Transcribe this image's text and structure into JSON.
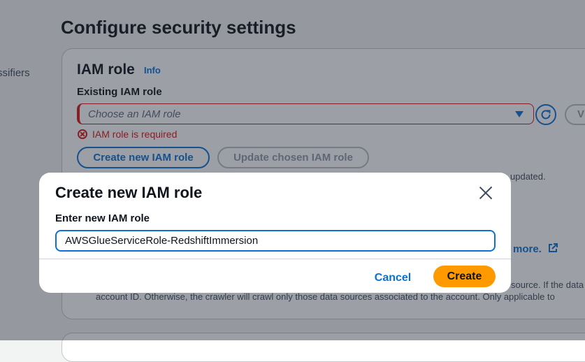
{
  "sidebar": {
    "partial_item": "ssifiers"
  },
  "page": {
    "title": "Configure security settings"
  },
  "iam_section": {
    "heading": "IAM role",
    "info_label": "Info",
    "field_label": "Existing IAM role",
    "select_placeholder": "Choose an IAM role",
    "view_label": "V",
    "error_text": "IAM role is required",
    "create_button": "Create new IAM role",
    "update_button": "Update chosen IAM role",
    "updated_text": "updated.",
    "learn_more": "more.",
    "description_line1": "source. If the data",
    "description_line2": "account ID. Otherwise, the crawler will crawl only those data sources associated to the account. Only applicable to"
  },
  "modal": {
    "title": "Create new IAM role",
    "input_label": "Enter new IAM role",
    "input_value": "AWSGlueServiceRole-RedshiftImmersion",
    "cancel_label": "Cancel",
    "create_label": "Create"
  },
  "colors": {
    "accent": "#0972d3",
    "primary_button": "#ff9900",
    "error": "#d91515"
  }
}
